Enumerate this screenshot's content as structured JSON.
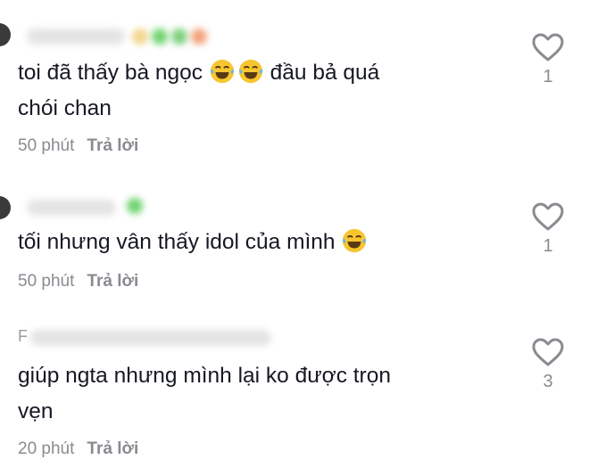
{
  "comments": [
    {
      "user_initial": "",
      "text_before": "toi đã thấy bà ngọc ",
      "emoji_count": 2,
      "text_after": " đầu bả quá",
      "text_line2": "chói chan",
      "time": "50 phút",
      "reply_label": "Trả lời",
      "likes": "1"
    },
    {
      "user_initial": "",
      "text_before": "tối nhưng vân thấy idol của mình ",
      "emoji_count": 1,
      "text_after": "",
      "text_line2": "",
      "time": "50 phút",
      "reply_label": "Trả lời",
      "likes": "1"
    },
    {
      "user_initial": "F",
      "text_before": "giúp ngta nhưng mình lại ko được trọn",
      "emoji_count": 0,
      "text_after": "",
      "text_line2": "vẹn",
      "time": "20 phút",
      "reply_label": "Trả lời",
      "likes": "3"
    }
  ],
  "icons": {
    "like": "heart-outline-icon",
    "emoji": "tears-of-joy-emoji-icon"
  },
  "colors": {
    "text": "#161823",
    "muted": "#8a8b91",
    "heart": "#8a8b91"
  }
}
